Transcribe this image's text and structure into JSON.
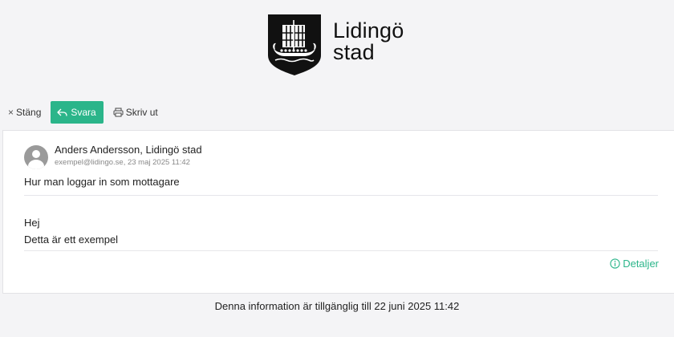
{
  "logo": {
    "line1": "Lidingö",
    "line2": "stad",
    "icon": "viking-ship-shield-icon"
  },
  "toolbar": {
    "close_label": "Stäng",
    "close_icon": "×",
    "reply_label": "Svara",
    "print_label": "Skriv ut"
  },
  "message": {
    "sender_name": "Anders Andersson, Lidingö stad",
    "sender_meta": "exempel@lidingo.se, 23 maj 2025 11:42",
    "subject": "Hur man loggar in som mottagare",
    "body_line1": "Hej",
    "body_line2": "Detta är ett exempel",
    "details_label": "Detaljer"
  },
  "footer": {
    "text": "Denna information är tillgänglig till 22 juni 2025 11:42"
  },
  "colors": {
    "accent": "#2bb58a",
    "background": "#f4f4f6",
    "card": "#ffffff"
  }
}
